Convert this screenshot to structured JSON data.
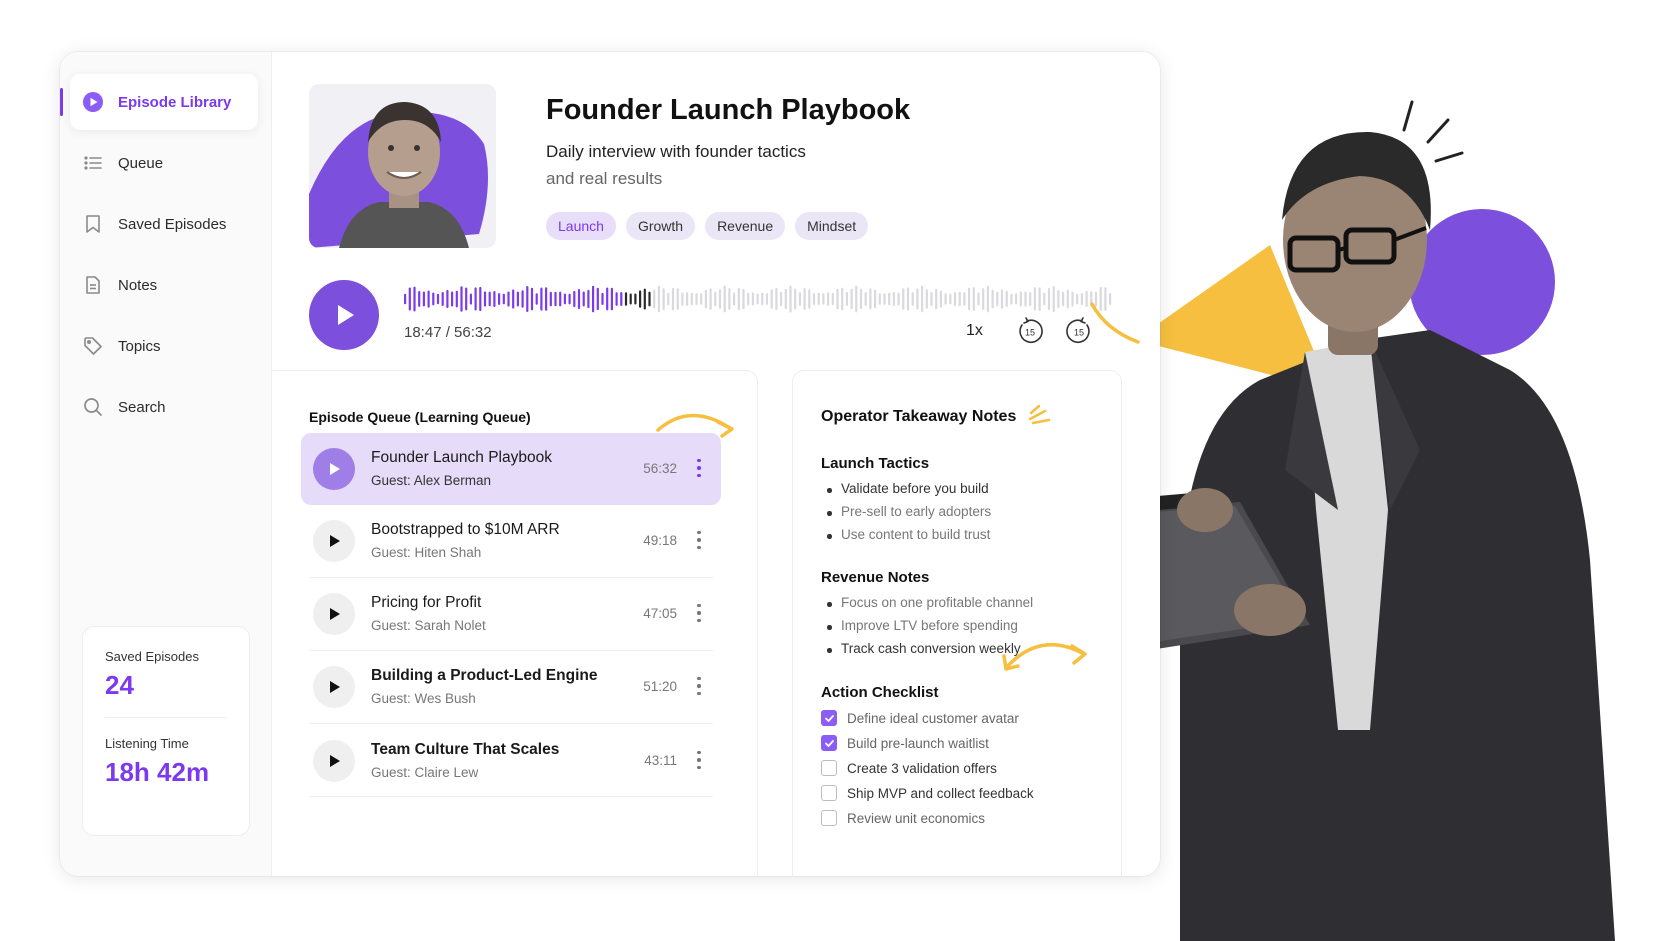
{
  "sidebar": {
    "items": [
      {
        "label": "Episode Library",
        "icon": "play-circle-icon"
      },
      {
        "label": "Queue",
        "icon": "list-icon"
      },
      {
        "label": "Saved Episodes",
        "icon": "bookmark-icon"
      },
      {
        "label": "Notes",
        "icon": "document-icon"
      },
      {
        "label": "Topics",
        "icon": "tag-icon"
      },
      {
        "label": "Search",
        "icon": "search-icon"
      }
    ],
    "stats": [
      {
        "label": "Saved Episodes",
        "value": "24"
      },
      {
        "label": "Listening Time",
        "value": "18h 42m"
      }
    ]
  },
  "episode": {
    "title": "Founder Launch Playbook",
    "subtitle_line1": "Daily interview with founder tactics",
    "subtitle_line2": "and real results",
    "tags": [
      "Launch",
      "Growth",
      "Revenue",
      "Mindset"
    ]
  },
  "player": {
    "time": "18:47 / 56:32",
    "speed": "1x",
    "skip_back": "15",
    "skip_forward": "15",
    "progress": 0.33
  },
  "queue": {
    "title": "Episode Queue (Learning Queue)",
    "items": [
      {
        "title": "Founder Launch Playbook",
        "guest": "Guest: Alex Berman",
        "duration": "56:32"
      },
      {
        "title": "Bootstrapped to $10M ARR",
        "guest": "Guest: Hiten Shah",
        "duration": "49:18"
      },
      {
        "title": "Pricing for Profit",
        "guest": "Guest: Sarah Nolet",
        "duration": "47:05"
      },
      {
        "title": "Building a Product-Led Engine",
        "guest": "Guest: Wes Bush",
        "duration": "51:20"
      },
      {
        "title": "Team Culture That Scales",
        "guest": "Guest: Claire Lew",
        "duration": "43:11"
      }
    ]
  },
  "notes": {
    "title": "Operator Takeaway Notes",
    "sections": [
      {
        "title": "Launch Tactics",
        "bullets": [
          "Validate before you build",
          "Pre-sell to early adopters",
          "Use content to build trust"
        ]
      },
      {
        "title": "Revenue Notes",
        "bullets": [
          "Focus on one profitable channel",
          "Improve LTV before spending",
          "Track cash conversion weekly"
        ]
      }
    ],
    "checklist_title": "Action Checklist",
    "checklist": [
      {
        "label": "Define ideal customer avatar",
        "checked": true
      },
      {
        "label": "Build pre-launch waitlist",
        "checked": true
      },
      {
        "label": "Create 3 validation offers",
        "checked": false
      },
      {
        "label": "Ship MVP and collect feedback",
        "checked": false
      },
      {
        "label": "Review unit economics",
        "checked": false
      }
    ]
  },
  "colors": {
    "accent": "#7c3aed",
    "accent_soft": "#e6dcf9",
    "deco_yellow": "#f6bf3f",
    "deco_purple": "#7c4fdc"
  }
}
